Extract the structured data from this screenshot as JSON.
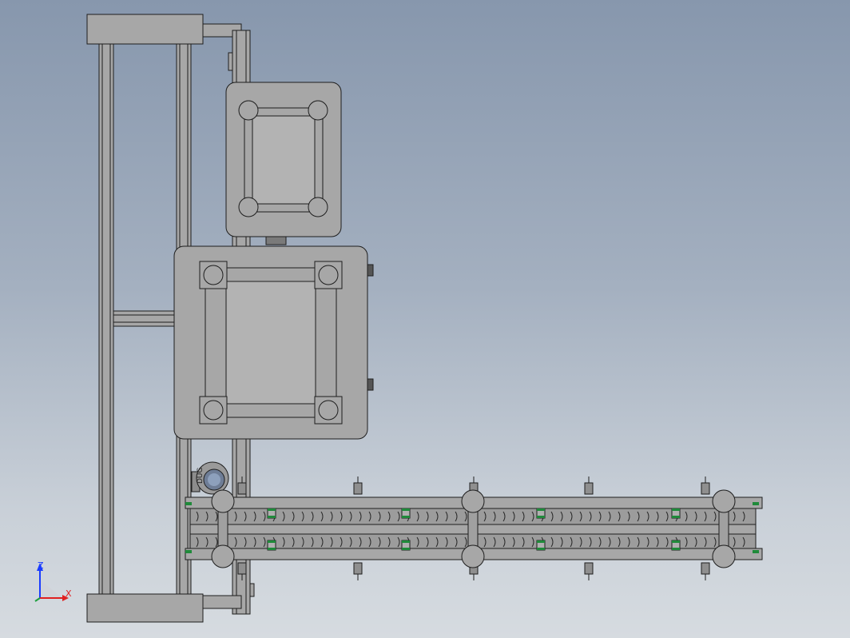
{
  "viewport": {
    "background_top": "#8797ad",
    "background_bottom": "#d6dbe0",
    "part_fill": "#a7a7a7",
    "edge_color": "#1e1e1e",
    "green_accent": "#1f8a3a"
  },
  "motor_label": "DUG",
  "triad": {
    "z_label": "Z",
    "x_label": "X",
    "z_color": "#1a3cff",
    "x_color": "#e02020",
    "y_color": "#20a040"
  }
}
